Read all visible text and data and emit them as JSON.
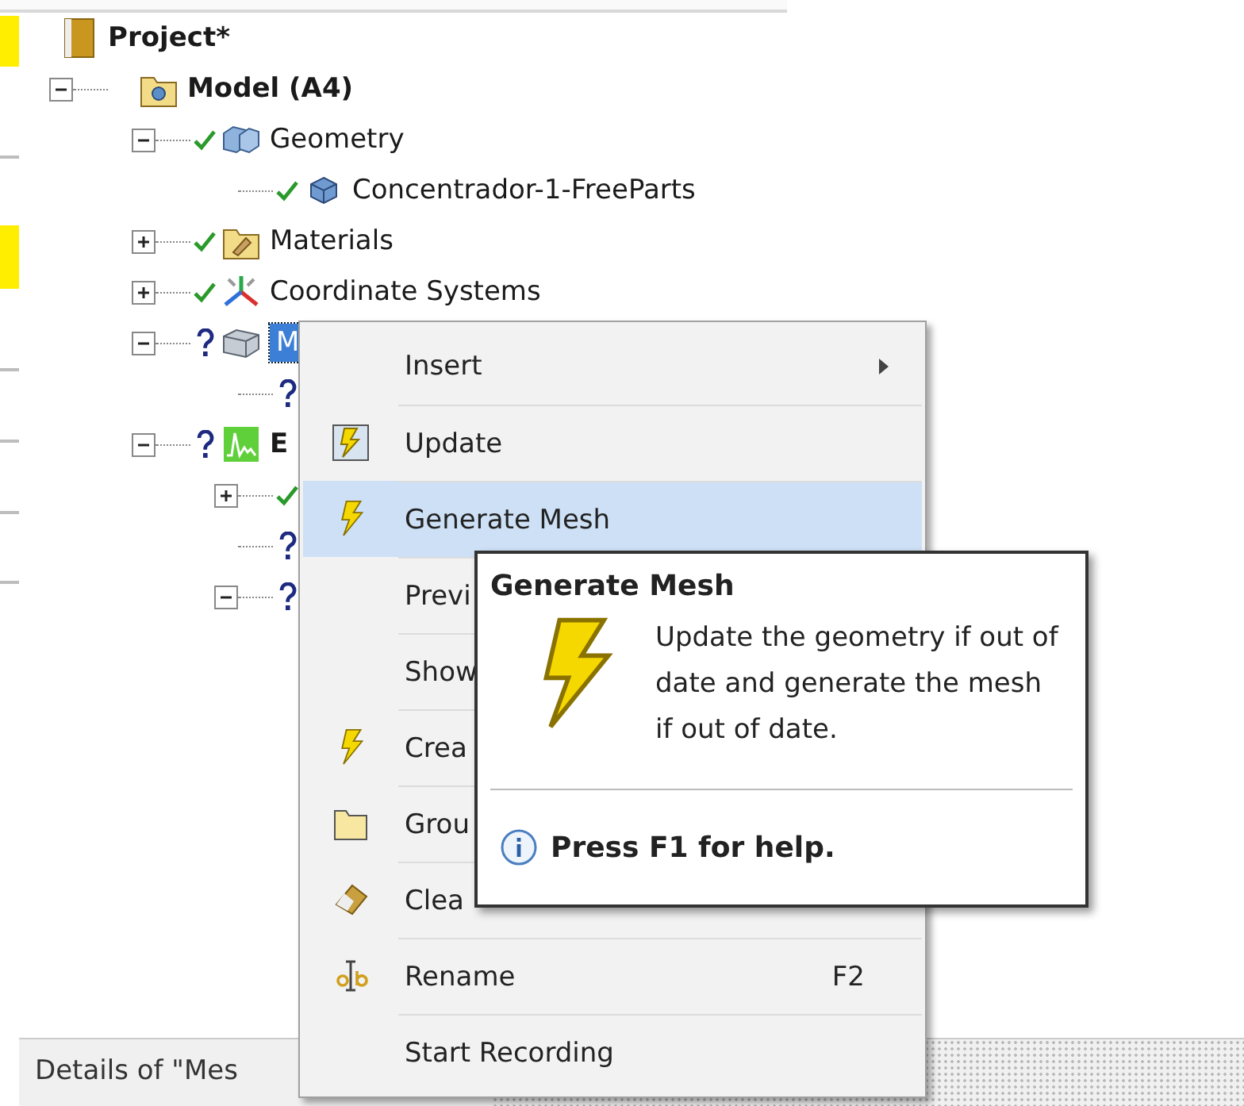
{
  "tree": {
    "label": "Project*",
    "kind": "project",
    "bold": true,
    "selected": false,
    "children": [
      {
        "label": "Model (A4)",
        "kind": "model",
        "bold": true,
        "selected": false,
        "expanded": true,
        "children": [
          {
            "label": "Geometry",
            "kind": "geometry",
            "up_to_date": true,
            "selected": false,
            "expanded": true,
            "children": [
              {
                "label": "Concentrador-1-FreeParts",
                "kind": "part",
                "up_to_date": true,
                "selected": false
              }
            ]
          },
          {
            "label": "Materials",
            "kind": "materials",
            "up_to_date": true,
            "selected": false,
            "expanded": false
          },
          {
            "label": "Coordinate Systems",
            "kind": "coords",
            "up_to_date": true,
            "selected": false,
            "expanded": false
          },
          {
            "label": "M",
            "kind": "mesh",
            "up_to_date": false,
            "selected": true,
            "expanded": true,
            "children": [
              {
                "up_to_date": false
              }
            ]
          },
          {
            "label": "E",
            "kind": "solution",
            "up_to_date": false,
            "bold": true,
            "selected": false,
            "expanded": true,
            "children": [
              {
                "up_to_date": true,
                "expanded": false
              },
              {
                "up_to_date": false
              },
              {
                "up_to_date": false,
                "expanded": true
              }
            ]
          }
        ]
      }
    ]
  },
  "context_menu": {
    "items": [
      {
        "label": "Insert",
        "submenu": true,
        "selected": false
      },
      {
        "label": "Update",
        "selected": false
      },
      {
        "label": "Generate Mesh",
        "selected": true
      },
      {
        "label": "Previ",
        "selected": false
      },
      {
        "label": "Show",
        "selected": false
      },
      {
        "label": "Crea",
        "selected": false
      },
      {
        "label": "Grou",
        "selected": false
      },
      {
        "label": "Clea",
        "selected": false
      },
      {
        "label": "Rename",
        "shortcut": "F2",
        "selected": false
      },
      {
        "label": "Start Recording",
        "selected": false
      }
    ]
  },
  "tooltip": {
    "title": "Generate Mesh",
    "body": "Update the geometry if out of date and generate the mesh if out of date.",
    "footer": "Press F1 for help."
  },
  "status_bar": {
    "text": "Details of \"Mes"
  }
}
